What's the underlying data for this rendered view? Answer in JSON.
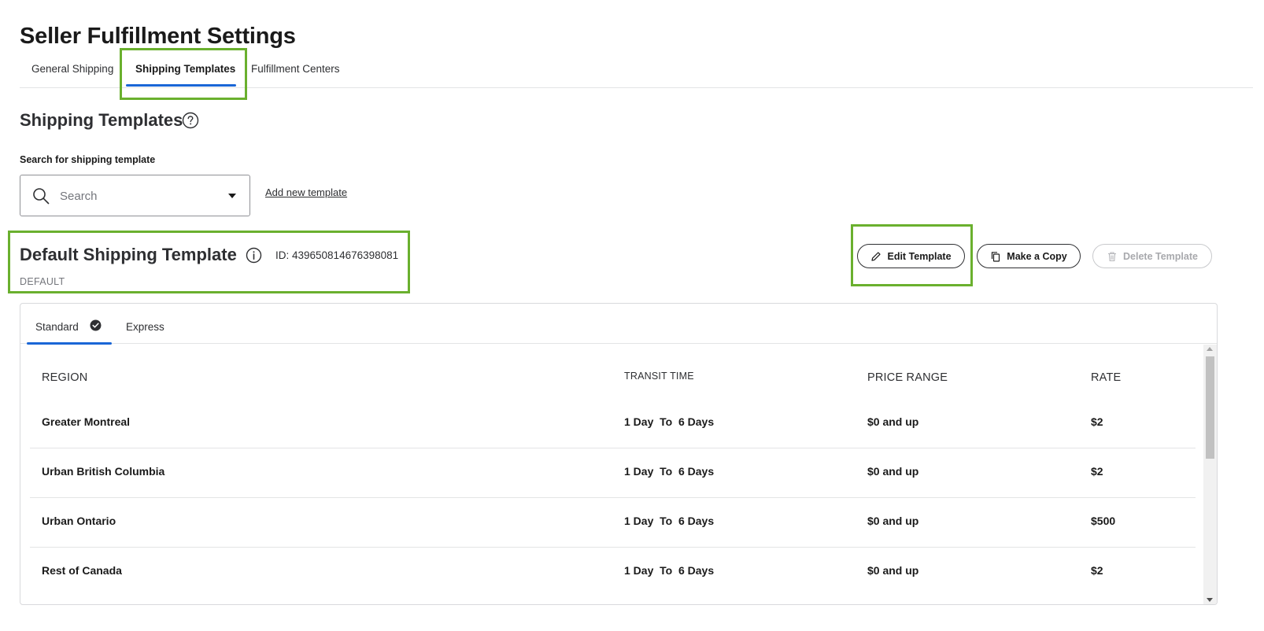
{
  "page": {
    "title": "Seller Fulfillment Settings"
  },
  "top_tabs": [
    {
      "label": "General Shipping",
      "active": false
    },
    {
      "label": "Shipping Templates",
      "active": true
    },
    {
      "label": "Fulfillment Centers",
      "active": false
    }
  ],
  "section": {
    "title": "Shipping Templates",
    "help_icon": "question-circle-icon"
  },
  "search": {
    "label": "Search for shipping template",
    "placeholder": "Search",
    "value": "",
    "search_icon": "search-icon",
    "dropdown_icon": "caret-down-icon"
  },
  "add_template_link": "Add new template",
  "template": {
    "name": "Default Shipping Template",
    "info_icon": "info-circle-icon",
    "id_text": "ID: 439650814676398081",
    "tag": "DEFAULT"
  },
  "actions": {
    "edit": {
      "label": "Edit Template",
      "icon": "pencil-icon"
    },
    "copy": {
      "label": "Make a Copy",
      "icon": "copy-icon"
    },
    "delete": {
      "label": "Delete Template",
      "icon": "trash-icon",
      "disabled": true
    }
  },
  "inner_tabs": [
    {
      "label": "Standard",
      "active": true,
      "icon": "check-circle-icon"
    },
    {
      "label": "Express",
      "active": false
    }
  ],
  "table": {
    "headers": {
      "region": "REGION",
      "transit": "TRANSIT TIME",
      "price": "PRICE RANGE",
      "rate": "RATE"
    },
    "rows": [
      {
        "region": "Greater Montreal",
        "transit": "1 Day  To  6 Days",
        "price": "$0 and up",
        "rate": "$2"
      },
      {
        "region": "Urban British Columbia",
        "transit": "1 Day  To  6 Days",
        "price": "$0 and up",
        "rate": "$2"
      },
      {
        "region": "Urban Ontario",
        "transit": "1 Day  To  6 Days",
        "price": "$0 and up",
        "rate": "$500"
      },
      {
        "region": "Rest of Canada",
        "transit": "1 Day  To  6 Days",
        "price": "$0 and up",
        "rate": "$2"
      }
    ]
  },
  "colors": {
    "accent": "#1a66d6",
    "highlight": "#6ab02e",
    "text": "#2e2f32",
    "muted": "#74767c"
  }
}
